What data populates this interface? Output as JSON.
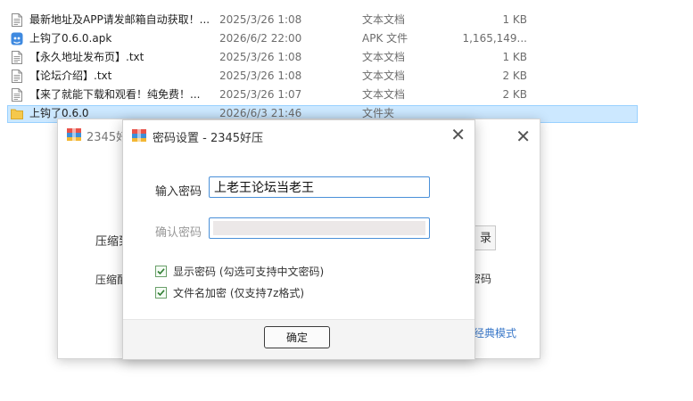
{
  "files": [
    {
      "name": "最新地址及APP请发邮箱自动获取！...",
      "date": "2025/3/26 1:08",
      "type": "文本文档",
      "size": "1 KB",
      "icon": "text-file-icon",
      "selected": false
    },
    {
      "name": "上钩了0.6.0.apk",
      "date": "2026/6/2 22:00",
      "type": "APK 文件",
      "size": "1,165,149...",
      "icon": "apk-file-icon",
      "selected": false
    },
    {
      "name": "【永久地址发布页】.txt",
      "date": "2025/3/26 1:08",
      "type": "文本文档",
      "size": "1 KB",
      "icon": "text-file-icon",
      "selected": false
    },
    {
      "name": "【论坛介绍】.txt",
      "date": "2025/3/26 1:08",
      "type": "文本文档",
      "size": "2 KB",
      "icon": "text-file-icon",
      "selected": false
    },
    {
      "name": "【来了就能下载和观看！纯免费！...",
      "date": "2025/3/26 1:07",
      "type": "文本文档",
      "size": "2 KB",
      "icon": "text-file-icon",
      "selected": false
    },
    {
      "name": "上钩了0.6.0",
      "date": "2026/6/3 21:46",
      "type": "文件夹",
      "size": "",
      "icon": "folder-icon",
      "selected": true
    }
  ],
  "bg_window": {
    "title": "2345好",
    "label1": "压缩到",
    "label2": "压缩配",
    "browse_btn": "录",
    "text3": "密码",
    "classic_link": "经典模式"
  },
  "dialog": {
    "title": "密码设置 - 2345好压",
    "password_label": "输入密码",
    "password_value": "上老王论坛当老王",
    "confirm_label": "确认密码",
    "show_password_label": "显示密码 (勾选可支持中文密码)",
    "show_password_checked": true,
    "encrypt_names_label": "文件名加密 (仅支持7z格式)",
    "encrypt_names_checked": true,
    "ok_label": "确定"
  },
  "colors": {
    "selection": "#cce8ff",
    "accent_blue": "#4a90d9",
    "folder": "#f5c84c",
    "link": "#3a78c9"
  }
}
